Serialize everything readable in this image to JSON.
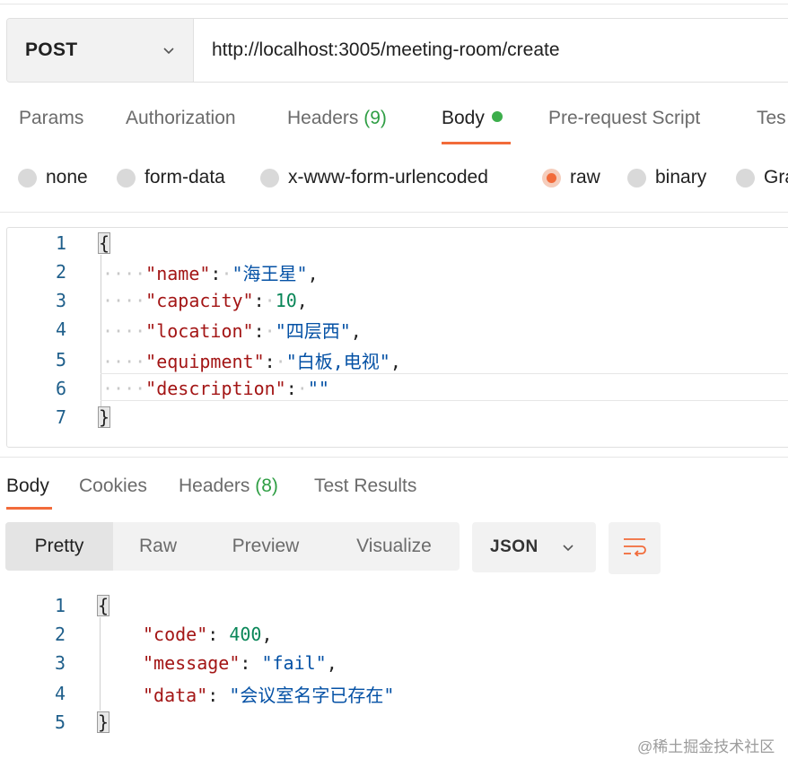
{
  "request": {
    "method": "POST",
    "url": "http://localhost:3005/meeting-room/create"
  },
  "request_tabs": [
    {
      "label": "Params"
    },
    {
      "label": "Authorization"
    },
    {
      "label": "Headers",
      "count": "(9)"
    },
    {
      "label": "Body",
      "active": true,
      "indicator": "green-dot"
    },
    {
      "label": "Pre-request Script"
    },
    {
      "label": "Tes"
    }
  ],
  "body_types": [
    {
      "label": "none"
    },
    {
      "label": "form-data"
    },
    {
      "label": "x-www-form-urlencoded"
    },
    {
      "label": "raw",
      "selected": true
    },
    {
      "label": "binary"
    },
    {
      "label": "Gra"
    }
  ],
  "request_body": {
    "line_numbers": [
      "1",
      "2",
      "3",
      "4",
      "5",
      "6",
      "7"
    ],
    "open_brace": "{",
    "close_brace": "}",
    "fields": [
      {
        "key": "\"name\"",
        "value": "\"海王星\"",
        "comma": ","
      },
      {
        "key": "\"capacity\"",
        "value": "10",
        "comma": ","
      },
      {
        "key": "\"location\"",
        "value": "\"四层西\"",
        "comma": ","
      },
      {
        "key": "\"equipment\"",
        "value": "\"白板,电视\"",
        "comma": ","
      },
      {
        "key": "\"description\"",
        "value": "\"\"",
        "comma": ""
      }
    ]
  },
  "response_tabs": [
    {
      "label": "Body",
      "active": true
    },
    {
      "label": "Cookies"
    },
    {
      "label": "Headers",
      "count": "(8)"
    },
    {
      "label": "Test Results"
    }
  ],
  "view_modes": [
    {
      "label": "Pretty",
      "active": true
    },
    {
      "label": "Raw"
    },
    {
      "label": "Preview"
    },
    {
      "label": "Visualize"
    }
  ],
  "format_select": "JSON",
  "response_body": {
    "line_numbers": [
      "1",
      "2",
      "3",
      "4",
      "5"
    ],
    "open_brace": "{",
    "close_brace": "}",
    "fields": [
      {
        "key": "\"code\"",
        "value": "400",
        "comma": ","
      },
      {
        "key": "\"message\"",
        "value": "\"fail\"",
        "comma": ","
      },
      {
        "key": "\"data\"",
        "value": "\"会议室名字已存在\"",
        "comma": ""
      }
    ]
  },
  "watermark": "@稀土掘金技术社区",
  "colors": {
    "accent": "#f26b3a",
    "count_green": "#2f9e44",
    "json_key": "#a31515",
    "json_string": "#0451a5",
    "json_number": "#098658"
  }
}
